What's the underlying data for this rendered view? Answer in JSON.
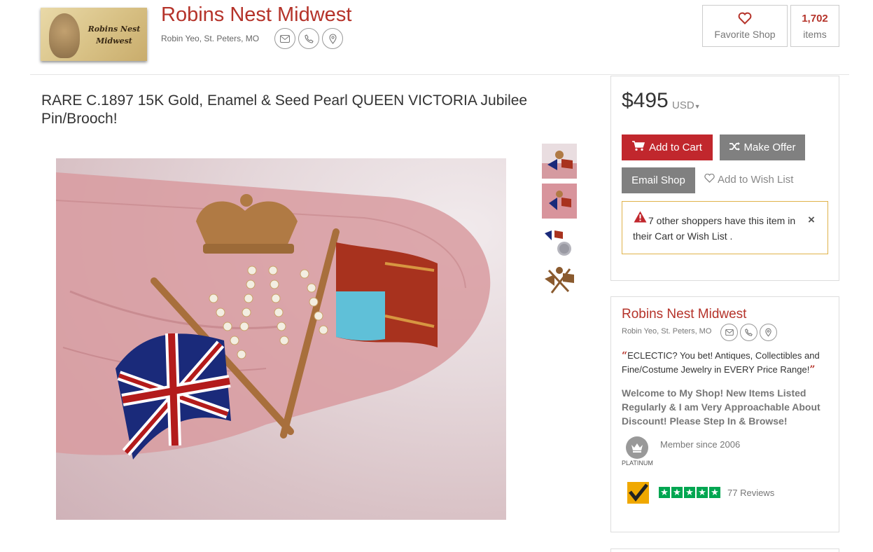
{
  "header": {
    "logo_text": "Robins Nest Midwest",
    "shop_name": "Robins Nest Midwest",
    "owner_location": "Robin Yeo, St. Peters, MO",
    "favorite_label": "Favorite Shop",
    "items_count": "1,702",
    "items_label": "items"
  },
  "product": {
    "title": "RARE C.1897 15K Gold, Enamel & Seed Pearl QUEEN VICTORIA Jubilee Pin/Brooch!",
    "thumbnail_count": 4
  },
  "purchase": {
    "price": "$495",
    "currency": "USD",
    "add_to_cart": "Add to Cart",
    "make_offer": "Make Offer",
    "email_shop": "Email Shop",
    "wish_list": "Add to Wish List",
    "alert_text": "7 other shoppers have this item in their Cart or Wish List .",
    "alert_close": "×"
  },
  "shop_card": {
    "name": "Robins Nest Midwest",
    "owner_location": "Robin Yeo, St. Peters, MO",
    "tagline": "ECLECTIC? You bet! Antiques, Collectibles and Fine/Costume Jewelry in EVERY Price Range!",
    "welcome": "Welcome to My Shop! New Items Listed Regularly & I am Very Approachable About Discount! Please Step In & Browse!",
    "tier": "PLATINUM",
    "member_since": "Member since 2006",
    "rating_stars": 5,
    "reviews": "77 Reviews"
  },
  "colors": {
    "brand_red": "#b5332a",
    "cart_red": "#c1272d",
    "gray_button": "#808080",
    "alert_border": "#e0b24a",
    "review_green": "#00a651"
  }
}
